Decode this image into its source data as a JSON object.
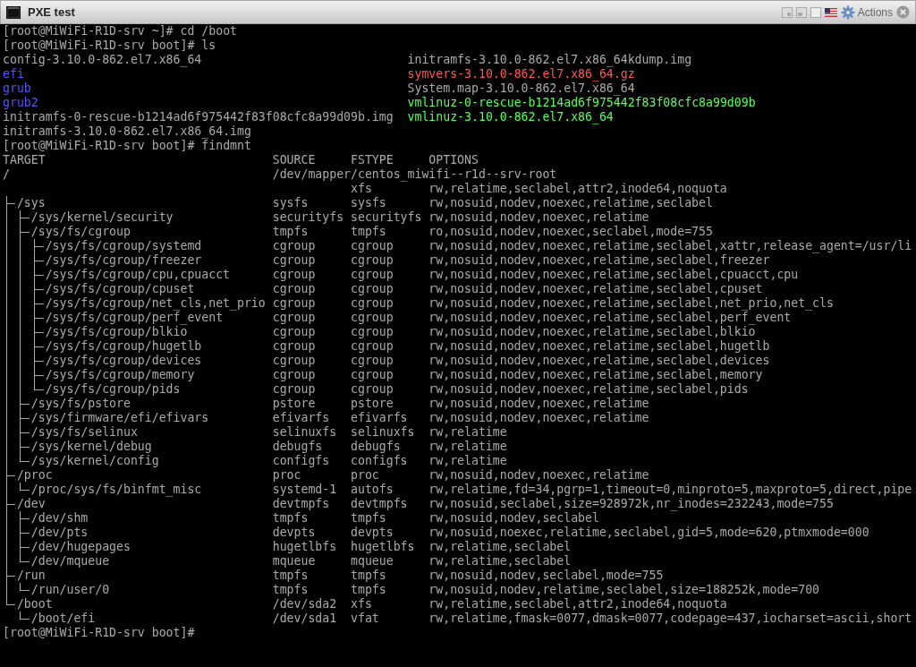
{
  "window": {
    "title": "PXE test",
    "actions_label": "Actions"
  },
  "console": {
    "commands_before": [
      "[root@MiWiFi-R1D-srv ~]# cd /boot",
      "[root@MiWiFi-R1D-srv boot]# ls"
    ],
    "ls_columns": [
      [
        {
          "name": "config-3.10.0-862.el7.x86_64",
          "color": "#aaaaaa"
        },
        {
          "name": "efi",
          "color": "#5555ff"
        },
        {
          "name": "grub",
          "color": "#5555ff"
        },
        {
          "name": "grub2",
          "color": "#5555ff"
        },
        {
          "name": "initramfs-0-rescue-b1214ad6f975442f83f08cfc8a99d09b.img",
          "color": "#aaaaaa"
        },
        {
          "name": "initramfs-3.10.0-862.el7.x86_64.img",
          "color": "#aaaaaa"
        }
      ],
      [
        {
          "name": "initramfs-3.10.0-862.el7.x86_64kdump.img",
          "color": "#aaaaaa"
        },
        {
          "name": "symvers-3.10.0-862.el7.x86_64.gz",
          "color": "#ff5555"
        },
        {
          "name": "System.map-3.10.0-862.el7.x86_64",
          "color": "#aaaaaa"
        },
        {
          "name": "vmlinuz-0-rescue-b1214ad6f975442f83f08cfc8a99d09b",
          "color": "#55ff55"
        },
        {
          "name": "vmlinuz-3.10.0-862.el7.x86_64",
          "color": "#55ff55"
        }
      ]
    ],
    "findmnt_command": "[root@MiWiFi-R1D-srv boot]# findmnt",
    "findmnt_headers": [
      "TARGET",
      "SOURCE",
      "FSTYPE",
      "OPTIONS"
    ],
    "mounts": [
      {
        "target": "/",
        "source": "/dev/mapper/centos_miwifi--r1d--srv-root",
        "source_wraps": true,
        "fstype": "xfs",
        "options": "rw,relatime,seclabel,attr2,inode64,noquota",
        "children": [
          {
            "target": "/sys",
            "source": "sysfs",
            "fstype": "sysfs",
            "options": "rw,nosuid,nodev,noexec,relatime,seclabel",
            "children": [
              {
                "target": "/sys/kernel/security",
                "source": "securityfs",
                "fstype": "securityfs",
                "options": "rw,nosuid,nodev,noexec,relatime"
              },
              {
                "target": "/sys/fs/cgroup",
                "source": "tmpfs",
                "fstype": "tmpfs",
                "options": "ro,nosuid,nodev,noexec,seclabel,mode=755",
                "children": [
                  {
                    "target": "/sys/fs/cgroup/systemd",
                    "source": "cgroup",
                    "fstype": "cgroup",
                    "options": "rw,nosuid,nodev,noexec,relatime,seclabel,xattr,release_agent=/usr/li"
                  },
                  {
                    "target": "/sys/fs/cgroup/freezer",
                    "source": "cgroup",
                    "fstype": "cgroup",
                    "options": "rw,nosuid,nodev,noexec,relatime,seclabel,freezer"
                  },
                  {
                    "target": "/sys/fs/cgroup/cpu,cpuacct",
                    "source": "cgroup",
                    "fstype": "cgroup",
                    "options": "rw,nosuid,nodev,noexec,relatime,seclabel,cpuacct,cpu"
                  },
                  {
                    "target": "/sys/fs/cgroup/cpuset",
                    "source": "cgroup",
                    "fstype": "cgroup",
                    "options": "rw,nosuid,nodev,noexec,relatime,seclabel,cpuset"
                  },
                  {
                    "target": "/sys/fs/cgroup/net_cls,net_prio",
                    "source": "cgroup",
                    "fstype": "cgroup",
                    "options": "rw,nosuid,nodev,noexec,relatime,seclabel,net_prio,net_cls"
                  },
                  {
                    "target": "/sys/fs/cgroup/perf_event",
                    "source": "cgroup",
                    "fstype": "cgroup",
                    "options": "rw,nosuid,nodev,noexec,relatime,seclabel,perf_event"
                  },
                  {
                    "target": "/sys/fs/cgroup/blkio",
                    "source": "cgroup",
                    "fstype": "cgroup",
                    "options": "rw,nosuid,nodev,noexec,relatime,seclabel,blkio"
                  },
                  {
                    "target": "/sys/fs/cgroup/hugetlb",
                    "source": "cgroup",
                    "fstype": "cgroup",
                    "options": "rw,nosuid,nodev,noexec,relatime,seclabel,hugetlb"
                  },
                  {
                    "target": "/sys/fs/cgroup/devices",
                    "source": "cgroup",
                    "fstype": "cgroup",
                    "options": "rw,nosuid,nodev,noexec,relatime,seclabel,devices"
                  },
                  {
                    "target": "/sys/fs/cgroup/memory",
                    "source": "cgroup",
                    "fstype": "cgroup",
                    "options": "rw,nosuid,nodev,noexec,relatime,seclabel,memory"
                  },
                  {
                    "target": "/sys/fs/cgroup/pids",
                    "source": "cgroup",
                    "fstype": "cgroup",
                    "options": "rw,nosuid,nodev,noexec,relatime,seclabel,pids"
                  }
                ]
              },
              {
                "target": "/sys/fs/pstore",
                "source": "pstore",
                "fstype": "pstore",
                "options": "rw,nosuid,nodev,noexec,relatime"
              },
              {
                "target": "/sys/firmware/efi/efivars",
                "source": "efivarfs",
                "fstype": "efivarfs",
                "options": "rw,nosuid,nodev,noexec,relatime"
              },
              {
                "target": "/sys/fs/selinux",
                "source": "selinuxfs",
                "fstype": "selinuxfs",
                "options": "rw,relatime"
              },
              {
                "target": "/sys/kernel/debug",
                "source": "debugfs",
                "fstype": "debugfs",
                "options": "rw,relatime"
              },
              {
                "target": "/sys/kernel/config",
                "source": "configfs",
                "fstype": "configfs",
                "options": "rw,relatime"
              }
            ]
          },
          {
            "target": "/proc",
            "source": "proc",
            "fstype": "proc",
            "options": "rw,nosuid,nodev,noexec,relatime",
            "children": [
              {
                "target": "/proc/sys/fs/binfmt_misc",
                "source": "systemd-1",
                "fstype": "autofs",
                "options": "rw,relatime,fd=34,pgrp=1,timeout=0,minproto=5,maxproto=5,direct,pipe"
              }
            ]
          },
          {
            "target": "/dev",
            "source": "devtmpfs",
            "fstype": "devtmpfs",
            "options": "rw,nosuid,seclabel,size=928972k,nr_inodes=232243,mode=755",
            "children": [
              {
                "target": "/dev/shm",
                "source": "tmpfs",
                "fstype": "tmpfs",
                "options": "rw,nosuid,nodev,seclabel"
              },
              {
                "target": "/dev/pts",
                "source": "devpts",
                "fstype": "devpts",
                "options": "rw,nosuid,noexec,relatime,seclabel,gid=5,mode=620,ptmxmode=000"
              },
              {
                "target": "/dev/hugepages",
                "source": "hugetlbfs",
                "fstype": "hugetlbfs",
                "options": "rw,relatime,seclabel"
              },
              {
                "target": "/dev/mqueue",
                "source": "mqueue",
                "fstype": "mqueue",
                "options": "rw,relatime,seclabel"
              }
            ]
          },
          {
            "target": "/run",
            "source": "tmpfs",
            "fstype": "tmpfs",
            "options": "rw,nosuid,nodev,seclabel,mode=755",
            "children": [
              {
                "target": "/run/user/0",
                "source": "tmpfs",
                "fstype": "tmpfs",
                "options": "rw,nosuid,nodev,relatime,seclabel,size=188252k,mode=700"
              }
            ]
          },
          {
            "target": "/boot",
            "source": "/dev/sda2",
            "fstype": "xfs",
            "options": "rw,relatime,seclabel,attr2,inode64,noquota",
            "children": [
              {
                "target": "/boot/efi",
                "source": "/dev/sda1",
                "fstype": "vfat",
                "options": "rw,relatime,fmask=0077,dmask=0077,codepage=437,iocharset=ascii,short"
              }
            ]
          }
        ]
      }
    ],
    "final_prompt": "[root@MiWiFi-R1D-srv boot]#"
  }
}
